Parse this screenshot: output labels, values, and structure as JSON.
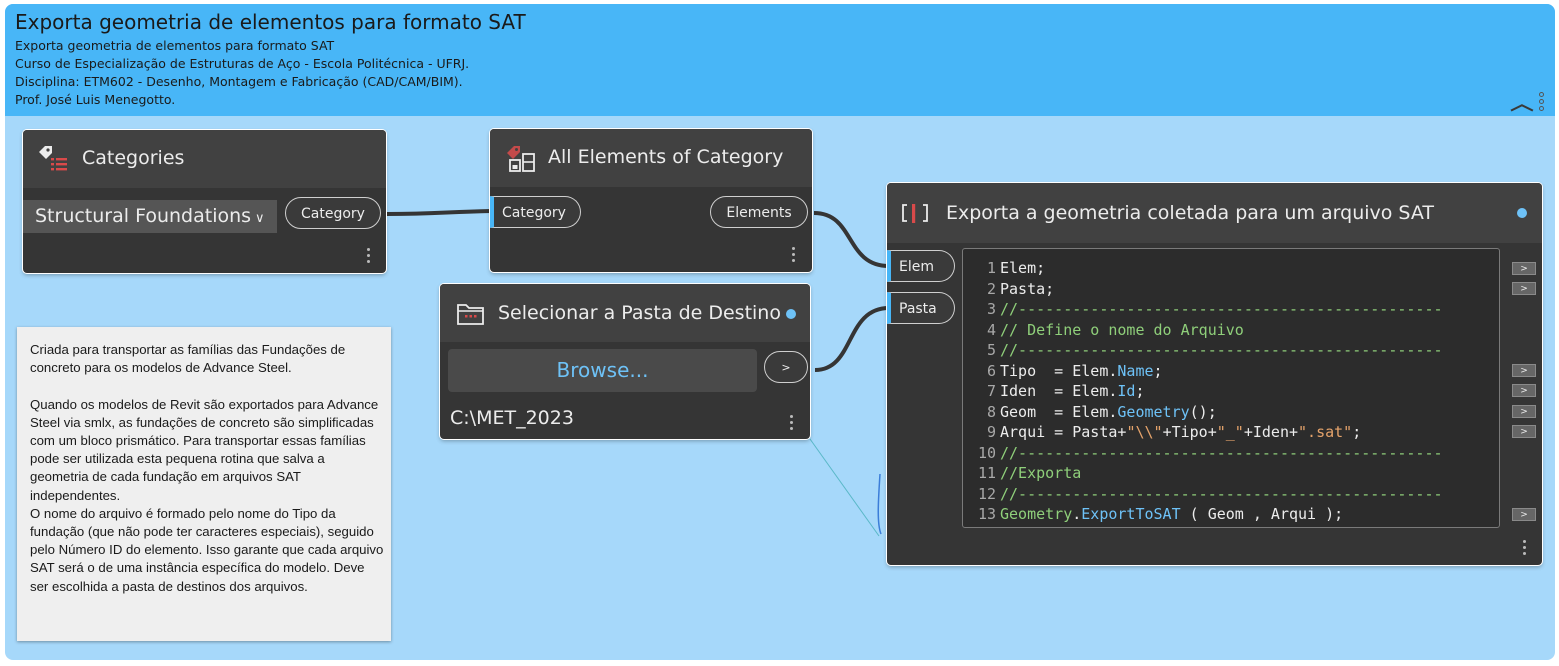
{
  "group": {
    "title": "Exporta geometria de elementos para formato SAT",
    "description_lines": [
      "Exporta geometria de elementos para formato SAT",
      "Curso de Especialização de Estruturas de Aço - Escola Politécnica - UFRJ.",
      "Disciplina:  ETM602 - Desenho, Montagem e Fabricação (CAD/CAM/BIM).",
      "Prof. José Luis Menegotto."
    ],
    "collapse_icon": "chevron-up-icon",
    "background_color": "#a6d8fa",
    "header_color": "#48b6f7"
  },
  "categories_node": {
    "title": "Categories",
    "icon": "categories-icon",
    "selected_value": "Structural Foundations",
    "output_port": "Category"
  },
  "all_elements_node": {
    "title": "All Elements of Category",
    "icon": "all-elements-icon",
    "input_port": "Category",
    "output_port": "Elements"
  },
  "folder_node": {
    "title": "Selecionar a Pasta de Destino",
    "icon": "folder-icon",
    "browse_label": "Browse...",
    "output_port": ">",
    "path": "C:\\MET_2023"
  },
  "code_node": {
    "title": "Exporta a geometria coletada para um arquivo SAT",
    "icon": "code-block-icon",
    "inputs": [
      "Elem",
      "Pasta"
    ],
    "lines": [
      {
        "n": "1",
        "text": "Elem;"
      },
      {
        "n": "2",
        "text": "Pasta;"
      },
      {
        "n": "3",
        "text": "//-----------------------------------------------"
      },
      {
        "n": "4",
        "text": "// Define o nome do Arquivo"
      },
      {
        "n": "5",
        "text": "//-----------------------------------------------"
      },
      {
        "n": "6",
        "text": "Tipo  = Elem.Name;"
      },
      {
        "n": "7",
        "text": "Iden  = Elem.Id;"
      },
      {
        "n": "8",
        "text": "Geom  = Elem.Geometry();"
      },
      {
        "n": "9",
        "text": "Arqui = Pasta+\"\\\\\"+Tipo+\"_\"+Iden+\".sat\";"
      },
      {
        "n": "10",
        "text": "//-----------------------------------------------"
      },
      {
        "n": "11",
        "text": "//Exporta"
      },
      {
        "n": "12",
        "text": "//-----------------------------------------------"
      },
      {
        "n": "13",
        "text": "Geometry.ExportToSAT ( Geom , Arqui );"
      }
    ],
    "output_arrow": ">"
  },
  "note": {
    "text": "Criada para transportar as famílias das Fundações de concreto para os modelos de Advance Steel.\n\nQuando os modelos de Revit são exportados para Advance Steel via smlx, as fundações de concreto são simplificadas com um bloco prismático. Para transportar essas famílias pode ser utilizada esta pequena rotina que salva a geometria de cada fundação em arquivos SAT independentes.\nO nome do arquivo é formado pelo nome do Tipo da fundação (que não pode ter caracteres especiais), seguido pelo Número ID do elemento. Isso garante que cada arquivo SAT será o de uma instância específica do modelo.  Deve ser escolhida a pasta de destinos dos arquivos."
  }
}
